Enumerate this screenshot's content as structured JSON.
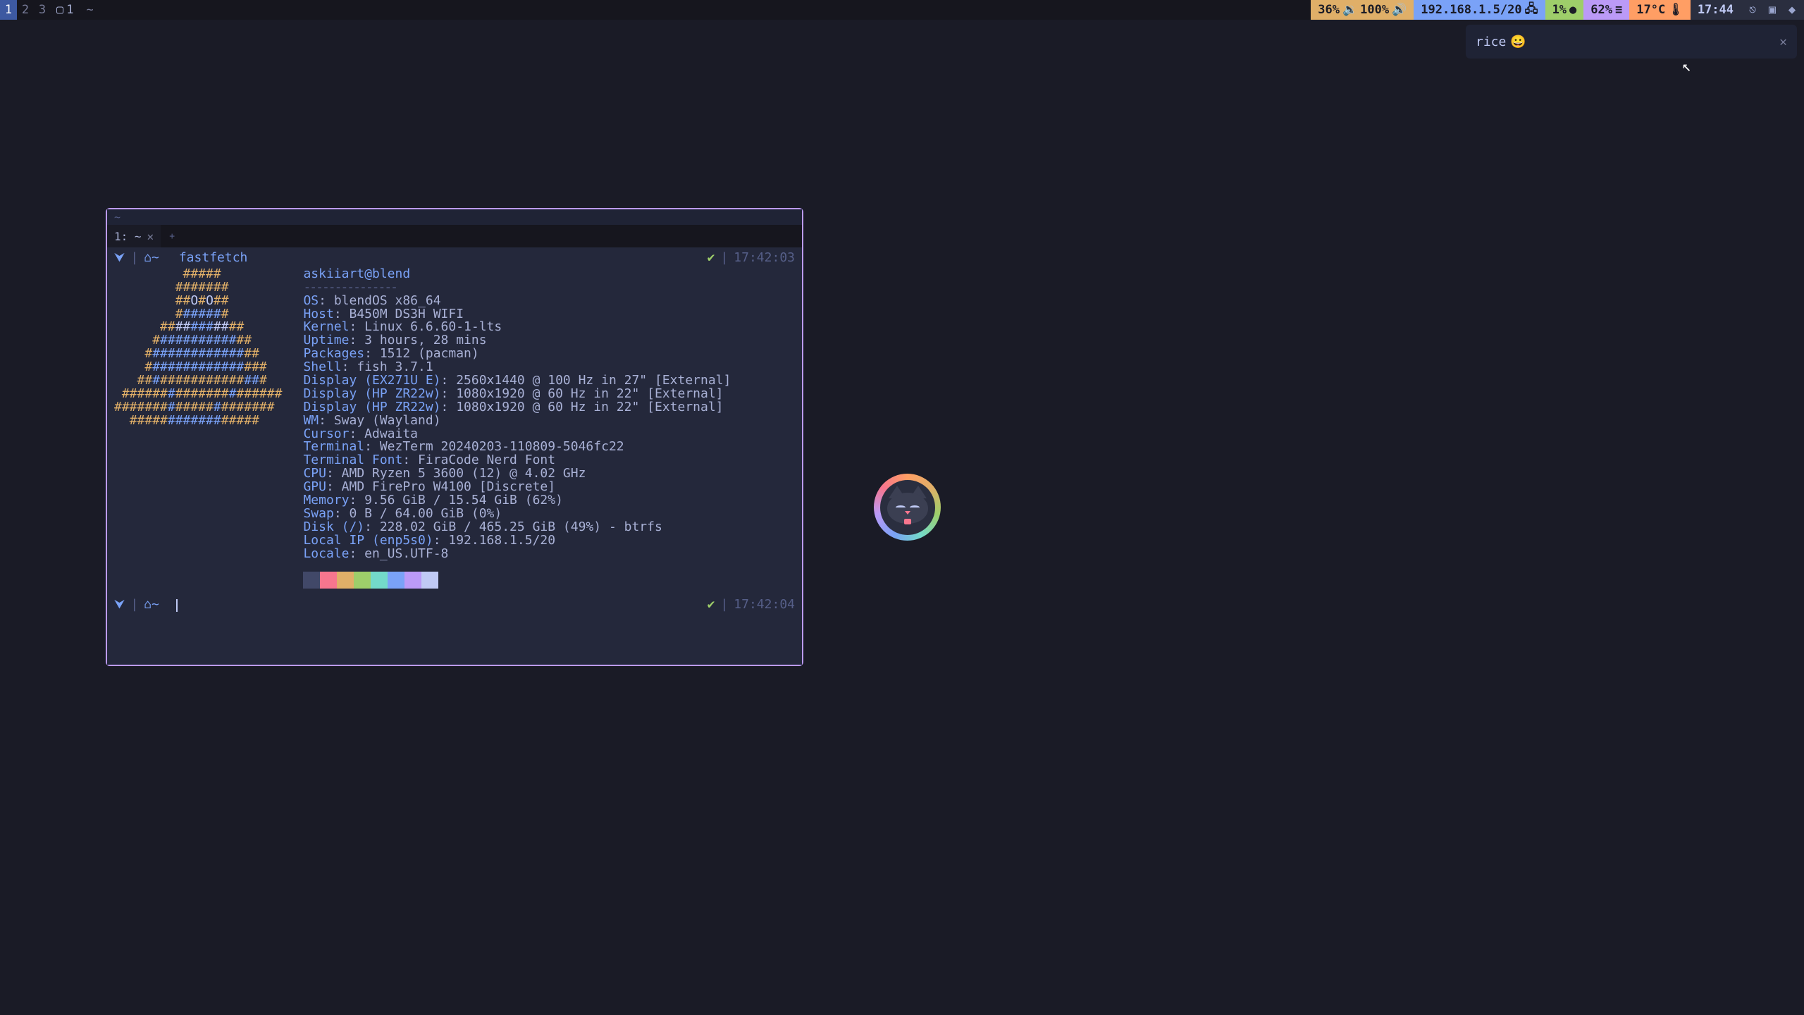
{
  "topbar": {
    "workspaces": [
      "1",
      "2",
      "3"
    ],
    "active_ws": 0,
    "scratch_icon": "▢",
    "scratch_label": "1",
    "music_icon": "~",
    "volume": {
      "a": "36%",
      "b": "100%",
      "icon": "🔊"
    },
    "net": {
      "ip": "192.168.1.5/20",
      "icon": "●"
    },
    "cpu": {
      "val": "1%",
      "icon": "●"
    },
    "mem": {
      "val": "62%",
      "icon": "≡"
    },
    "temp": {
      "val": "17°C",
      "icon": "🌡"
    },
    "clock": "17:44"
  },
  "notification": {
    "title": "rice",
    "emoji": "😀",
    "close": "✕"
  },
  "terminal": {
    "titlebar": "~",
    "tab": {
      "label": "1: ~",
      "close": "✕"
    },
    "newtab": "+",
    "prompt1": {
      "arch": "⮟",
      "home_icon": "⌂~",
      "cmd": "fastfetch",
      "check": "✔",
      "sep": "|",
      "ts": "17:42:03"
    },
    "prompt2": {
      "arch": "⮟",
      "home_icon": "⌂~",
      "check": "✔",
      "sep": "|",
      "ts": "17:42:04"
    },
    "userhost": "askiiart@blend",
    "underline": "---------------",
    "rows": [
      {
        "k": "OS",
        "v": "blendOS x86_64"
      },
      {
        "k": "Host",
        "v": "B450M DS3H WIFI"
      },
      {
        "k": "Kernel",
        "v": "Linux 6.6.60-1-lts"
      },
      {
        "k": "Uptime",
        "v": "3 hours, 28 mins"
      },
      {
        "k": "Packages",
        "v": "1512 (pacman)"
      },
      {
        "k": "Shell",
        "v": "fish 3.7.1"
      },
      {
        "k": "Display (EX271U E)",
        "v": "2560x1440 @ 100 Hz in 27\" [External]"
      },
      {
        "k": "Display (HP ZR22w)",
        "v": "1080x1920 @ 60 Hz in 22\" [External]"
      },
      {
        "k": "Display (HP ZR22w)",
        "v": "1080x1920 @ 60 Hz in 22\" [External]"
      },
      {
        "k": "WM",
        "v": "Sway (Wayland)"
      },
      {
        "k": "Cursor",
        "v": "Adwaita"
      },
      {
        "k": "Terminal",
        "v": "WezTerm 20240203-110809-5046fc22"
      },
      {
        "k": "Terminal Font",
        "v": "FiraCode Nerd Font"
      },
      {
        "k": "CPU",
        "v": "AMD Ryzen 5 3600 (12) @ 4.02 GHz"
      },
      {
        "k": "GPU",
        "v": "AMD FirePro W4100 [Discrete]"
      },
      {
        "k": "Memory",
        "v": "9.56 GiB / 15.54 GiB (62%)"
      },
      {
        "k": "Swap",
        "v": "0 B / 64.00 GiB (0%)"
      },
      {
        "k": "Disk (/)",
        "v": "228.02 GiB / 465.25 GiB (49%) - btrfs"
      },
      {
        "k": "Local IP (enp5s0)",
        "v": "192.168.1.5/20"
      },
      {
        "k": "Locale",
        "v": "en_US.UTF-8"
      }
    ],
    "swatches": [
      "#414868",
      "#f7768e",
      "#e0af68",
      "#9ece6a",
      "#73daca",
      "#7aa2f7",
      "#bb9af7",
      "#c0caf5"
    ]
  },
  "logo": [
    {
      "pad": 9,
      "seg": [
        [
          "y",
          "#####"
        ]
      ]
    },
    {
      "pad": 8,
      "seg": [
        [
          "y",
          "#######"
        ]
      ]
    },
    {
      "pad": 8,
      "seg": [
        [
          "y",
          "##"
        ],
        [
          "w",
          "O"
        ],
        [
          "y",
          "#"
        ],
        [
          "w",
          "O"
        ],
        [
          "y",
          "##"
        ]
      ]
    },
    {
      "pad": 8,
      "seg": [
        [
          "y",
          "#"
        ],
        [
          "b",
          "#####"
        ],
        [
          "y",
          "#"
        ]
      ]
    },
    {
      "pad": 6,
      "seg": [
        [
          "y",
          "##"
        ],
        [
          "w",
          "##"
        ],
        [
          "b",
          "###"
        ],
        [
          "w",
          "##"
        ],
        [
          "y",
          "##"
        ]
      ]
    },
    {
      "pad": 5,
      "seg": [
        [
          "y",
          "#"
        ],
        [
          "b",
          "##########"
        ],
        [
          "y",
          "##"
        ]
      ]
    },
    {
      "pad": 4,
      "seg": [
        [
          "y",
          "#"
        ],
        [
          "b",
          "############"
        ],
        [
          "y",
          "##"
        ]
      ]
    },
    {
      "pad": 4,
      "seg": [
        [
          "y",
          "#"
        ],
        [
          "b",
          "############"
        ],
        [
          "y",
          "###"
        ]
      ]
    },
    {
      "pad": 3,
      "seg": [
        [
          "y",
          "##"
        ],
        [
          "b",
          "#"
        ],
        [
          "y",
          "###########"
        ],
        [
          "b",
          "##"
        ],
        [
          "y",
          "#"
        ]
      ]
    },
    {
      "pad": 1,
      "seg": [
        [
          "y",
          "######"
        ],
        [
          "b",
          "#"
        ],
        [
          "y",
          "#######"
        ],
        [
          "b",
          "#"
        ],
        [
          "y",
          "######"
        ]
      ]
    },
    {
      "pad": 0,
      "seg": [
        [
          "y",
          "#######"
        ],
        [
          "b",
          "#"
        ],
        [
          "y",
          "#####"
        ],
        [
          "b",
          "#"
        ],
        [
          "y",
          "#######"
        ]
      ]
    },
    {
      "pad": 2,
      "seg": [
        [
          "y",
          "#####"
        ],
        [
          "b",
          "#######"
        ],
        [
          "y",
          "#####"
        ]
      ]
    }
  ]
}
